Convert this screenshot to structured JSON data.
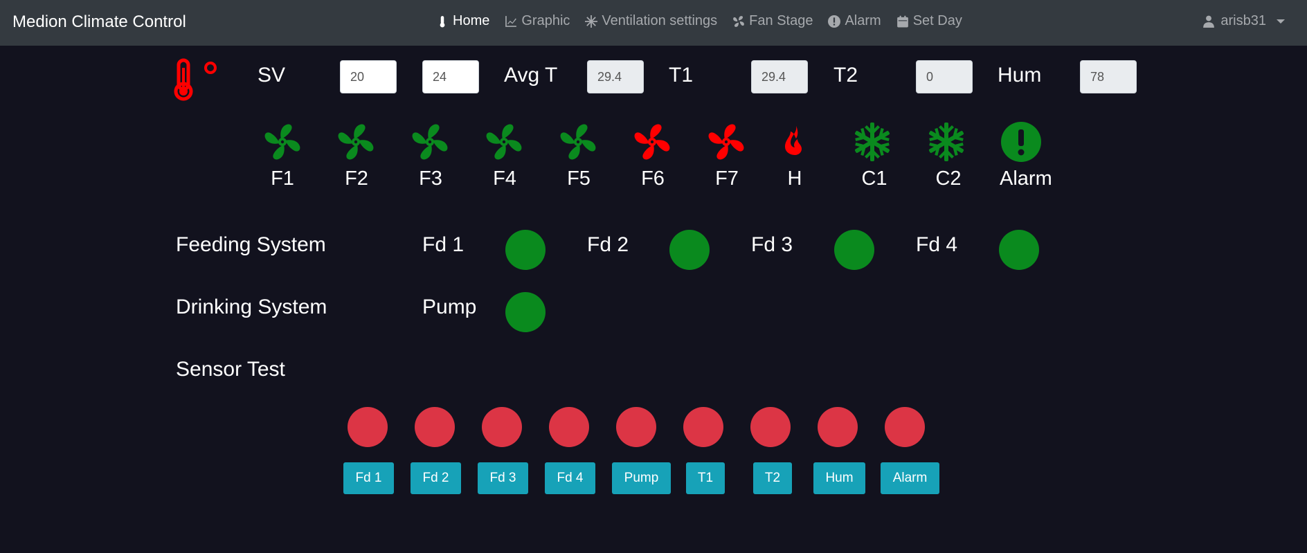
{
  "app": {
    "title": "Medion Climate Control"
  },
  "nav": {
    "items": [
      {
        "label": "Home",
        "icon": "thermometer-icon"
      },
      {
        "label": "Graphic",
        "icon": "line-chart-icon"
      },
      {
        "label": "Ventilation settings",
        "icon": "snowflake-icon"
      },
      {
        "label": "Fan Stage",
        "icon": "fan-icon"
      },
      {
        "label": "Alarm",
        "icon": "exclamation-circle-icon"
      },
      {
        "label": "Set Day",
        "icon": "calendar-icon"
      }
    ],
    "active": "Home",
    "user": "arisb31"
  },
  "readings": {
    "sv_label": "SV",
    "sv_low": "20",
    "sv_high": "24",
    "avg_label": "Avg T",
    "avg_value": "29.4",
    "t1_label": "T1",
    "t1_value": "29.4",
    "t2_label": "T2",
    "t2_value": "0",
    "hum_label": "Hum",
    "hum_value": "78"
  },
  "devices": [
    {
      "label": "F1",
      "icon": "fan-icon",
      "state": "on",
      "color": "#0a8a1e"
    },
    {
      "label": "F2",
      "icon": "fan-icon",
      "state": "on",
      "color": "#0a8a1e"
    },
    {
      "label": "F3",
      "icon": "fan-icon",
      "state": "on",
      "color": "#0a8a1e"
    },
    {
      "label": "F4",
      "icon": "fan-icon",
      "state": "on",
      "color": "#0a8a1e"
    },
    {
      "label": "F5",
      "icon": "fan-icon",
      "state": "on",
      "color": "#0a8a1e"
    },
    {
      "label": "F6",
      "icon": "fan-icon",
      "state": "off",
      "color": "#ff0000"
    },
    {
      "label": "F7",
      "icon": "fan-icon",
      "state": "off",
      "color": "#ff0000"
    },
    {
      "label": "H",
      "icon": "fire-icon",
      "state": "off",
      "color": "#ff0000"
    },
    {
      "label": "C1",
      "icon": "snowflake-icon",
      "state": "on",
      "color": "#0a8a1e"
    },
    {
      "label": "C2",
      "icon": "snowflake-icon",
      "state": "on",
      "color": "#0a8a1e"
    },
    {
      "label": "Alarm",
      "icon": "exclamation-circle-icon",
      "state": "on",
      "color": "#0a8a1e"
    }
  ],
  "feeding": {
    "title": "Feeding System",
    "items": [
      {
        "label": "Fd 1",
        "color": "#0a8a1e"
      },
      {
        "label": "Fd 2",
        "color": "#0a8a1e"
      },
      {
        "label": "Fd 3",
        "color": "#0a8a1e"
      },
      {
        "label": "Fd 4",
        "color": "#0a8a1e"
      }
    ]
  },
  "drinking": {
    "title": "Drinking System",
    "pump_label": "Pump",
    "pump_color": "#0a8a1e"
  },
  "sensor_test": {
    "title": "Sensor Test",
    "indicator_color": "#dc3545",
    "buttons": [
      "Fd 1",
      "Fd 2",
      "Fd 3",
      "Fd 4",
      "Pump",
      "T1",
      "T2",
      "Hum",
      "Alarm"
    ]
  },
  "colors": {
    "background": "#12121e",
    "navbar": "#343a40",
    "on": "#0a8a1e",
    "off": "#ff0000",
    "sensor": "#dc3545",
    "button": "#17a2b8"
  }
}
